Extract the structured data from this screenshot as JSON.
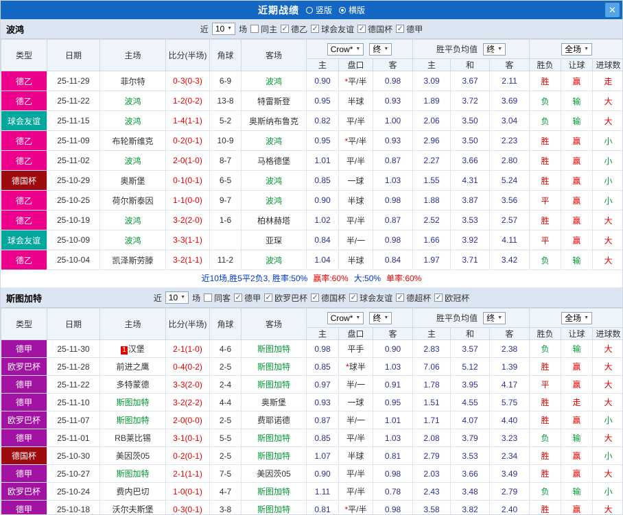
{
  "topbar": {
    "title": "近期战绩",
    "radio_vertical": "竖版",
    "radio_horizontal": "横版",
    "selected": "横版",
    "close_icon": "✕"
  },
  "table_header": {
    "col_type": "类型",
    "col_date": "日期",
    "col_home": "主场",
    "col_score": "比分(半场)",
    "col_corner": "角球",
    "col_away": "客场",
    "dd_company": "Crow*",
    "dd_final1": "终",
    "label_avg": "胜平负均值",
    "dd_final2": "终",
    "dd_fullmatch": "全场",
    "sub_home": "主",
    "sub_handicap": "盘口",
    "sub_away": "客",
    "sub_avg_home": "主",
    "sub_avg_draw": "和",
    "sub_avg_away": "客",
    "sub_result": "胜负",
    "sub_handicap_result": "让球",
    "sub_goals": "进球数"
  },
  "colors": {
    "league": {
      "德乙": "#EC008C",
      "球会友谊": "#00A79D",
      "德国杯": "#9E0B0F",
      "德甲": "#A313A3",
      "欧罗巴杯": "#A313A3"
    },
    "result": {
      "胜": "#E60000",
      "平": "#E60000",
      "负": "#009933",
      "赢": "#E60000",
      "输": "#009933",
      "走": "#E60000",
      "大": "#E60000",
      "小": "#009933"
    },
    "focus_team": "#009933",
    "score": "#E60000"
  },
  "sections": [
    {
      "team": "波鸿",
      "filter": {
        "recent_label": "近",
        "recent_value": "10",
        "matches_label": "场",
        "checkboxes": [
          {
            "label": "同主",
            "checked": false
          },
          {
            "label": "德乙",
            "checked": true
          },
          {
            "label": "球会友谊",
            "checked": true
          },
          {
            "label": "德国杯",
            "checked": true
          },
          {
            "label": "德甲",
            "checked": true
          }
        ]
      },
      "rows": [
        {
          "league": "德乙",
          "date": "25-11-29",
          "home": "菲尔特",
          "score": "0-3(0-3)",
          "corner": "6-9",
          "away": "波鸿",
          "odds": [
            "0.90",
            "*平/半",
            "0.98",
            "3.09",
            "3.67",
            "2.11"
          ],
          "results": [
            "胜",
            "赢",
            "走"
          ]
        },
        {
          "league": "德乙",
          "date": "25-11-22",
          "home": "波鸿",
          "score": "1-2(0-2)",
          "corner": "13-8",
          "away": "特雷斯登",
          "odds": [
            "0.95",
            "半球",
            "0.93",
            "1.89",
            "3.72",
            "3.69"
          ],
          "results": [
            "负",
            "输",
            "大"
          ]
        },
        {
          "league": "球会友谊",
          "date": "25-11-15",
          "home": "波鸿",
          "score": "1-4(1-1)",
          "corner": "5-2",
          "away": "奥斯纳布鲁克",
          "odds": [
            "0.82",
            "平/半",
            "1.00",
            "2.06",
            "3.50",
            "3.04"
          ],
          "results": [
            "负",
            "输",
            "大"
          ]
        },
        {
          "league": "德乙",
          "date": "25-11-09",
          "home": "布轮斯维克",
          "score": "0-2(0-1)",
          "corner": "10-9",
          "away": "波鸿",
          "odds": [
            "0.95",
            "*平/半",
            "0.93",
            "2.96",
            "3.50",
            "2.23"
          ],
          "results": [
            "胜",
            "赢",
            "小"
          ]
        },
        {
          "league": "德乙",
          "date": "25-11-02",
          "home": "波鸿",
          "score": "2-0(1-0)",
          "corner": "8-7",
          "away": "马格德堡",
          "odds": [
            "1.01",
            "平/半",
            "0.87",
            "2.27",
            "3.66",
            "2.80"
          ],
          "results": [
            "胜",
            "赢",
            "小"
          ]
        },
        {
          "league": "德国杯",
          "date": "25-10-29",
          "home": "奥斯堡",
          "score": "0-1(0-1)",
          "corner": "6-5",
          "away": "波鸿",
          "odds": [
            "0.85",
            "一球",
            "1.03",
            "1.55",
            "4.31",
            "5.24"
          ],
          "results": [
            "胜",
            "赢",
            "小"
          ]
        },
        {
          "league": "德乙",
          "date": "25-10-25",
          "home": "荷尔斯泰因",
          "score": "1-1(0-0)",
          "corner": "9-7",
          "away": "波鸿",
          "odds": [
            "0.90",
            "半球",
            "0.98",
            "1.88",
            "3.87",
            "3.56"
          ],
          "results": [
            "平",
            "赢",
            "小"
          ]
        },
        {
          "league": "德乙",
          "date": "25-10-19",
          "home": "波鸿",
          "score": "3-2(2-0)",
          "corner": "1-6",
          "away": "柏林赫塔",
          "odds": [
            "1.02",
            "平/半",
            "0.87",
            "2.52",
            "3.53",
            "2.57"
          ],
          "results": [
            "胜",
            "赢",
            "大"
          ]
        },
        {
          "league": "球会友谊",
          "date": "25-10-09",
          "home": "波鸿",
          "score": "3-3(1-1)",
          "corner": "",
          "away": "亚琛",
          "odds": [
            "0.84",
            "半/一",
            "0.98",
            "1.66",
            "3.92",
            "4.11"
          ],
          "results": [
            "平",
            "赢",
            "大"
          ]
        },
        {
          "league": "德乙",
          "date": "25-10-04",
          "home": "凯泽斯劳滕",
          "score": "3-2(1-1)",
          "corner": "11-2",
          "away": "波鸿",
          "odds": [
            "1.04",
            "半球",
            "0.84",
            "1.97",
            "3.71",
            "3.42"
          ],
          "results": [
            "负",
            "输",
            "大"
          ]
        }
      ],
      "summary": [
        {
          "text": "近10场,胜5平2负3, 胜率:50%",
          "color": "#0033CC"
        },
        {
          "text": "赢率:60%",
          "color": "#E60000"
        },
        {
          "text": "大:50%",
          "color": "#0033CC"
        },
        {
          "text": "单率:60%",
          "color": "#E60000"
        }
      ]
    },
    {
      "team": "斯图加特",
      "filter": {
        "recent_label": "近",
        "recent_value": "10",
        "matches_label": "场",
        "checkboxes": [
          {
            "label": "同客",
            "checked": false
          },
          {
            "label": "德甲",
            "checked": true
          },
          {
            "label": "欧罗巴杯",
            "checked": true
          },
          {
            "label": "德国杯",
            "checked": true
          },
          {
            "label": "球会友谊",
            "checked": true
          },
          {
            "label": "德超杯",
            "checked": true
          },
          {
            "label": "欧冠杯",
            "checked": true
          }
        ]
      },
      "rows": [
        {
          "league": "德甲",
          "date": "25-11-30",
          "home": "汉堡",
          "home_rank": "1",
          "score": "2-1(1-0)",
          "corner": "4-6",
          "away": "斯图加特",
          "odds": [
            "0.98",
            "平手",
            "0.90",
            "2.83",
            "3.57",
            "2.38"
          ],
          "results": [
            "负",
            "输",
            "大"
          ]
        },
        {
          "league": "欧罗巴杯",
          "date": "25-11-28",
          "home": "前进之鹰",
          "score": "0-4(0-2)",
          "corner": "2-5",
          "away": "斯图加特",
          "odds": [
            "0.85",
            "*球半",
            "1.03",
            "7.06",
            "5.12",
            "1.39"
          ],
          "results": [
            "胜",
            "赢",
            "大"
          ]
        },
        {
          "league": "德甲",
          "date": "25-11-22",
          "home": "多特蒙德",
          "score": "3-3(2-0)",
          "corner": "2-4",
          "away": "斯图加特",
          "odds": [
            "0.97",
            "半/一",
            "0.91",
            "1.78",
            "3.95",
            "4.17"
          ],
          "results": [
            "平",
            "赢",
            "大"
          ]
        },
        {
          "league": "德甲",
          "date": "25-11-10",
          "home": "斯图加特",
          "score": "3-2(2-2)",
          "corner": "4-4",
          "away": "奥斯堡",
          "odds": [
            "0.93",
            "一球",
            "0.95",
            "1.51",
            "4.55",
            "5.75"
          ],
          "results": [
            "胜",
            "走",
            "大"
          ]
        },
        {
          "league": "欧罗巴杯",
          "date": "25-11-07",
          "home": "斯图加特",
          "score": "2-0(0-0)",
          "corner": "2-5",
          "away": "费耶诺德",
          "odds": [
            "0.87",
            "半/一",
            "1.01",
            "1.71",
            "4.07",
            "4.40"
          ],
          "results": [
            "胜",
            "赢",
            "小"
          ]
        },
        {
          "league": "德甲",
          "date": "25-11-01",
          "home": "RB莱比锡",
          "score": "3-1(0-1)",
          "corner": "5-5",
          "away": "斯图加特",
          "odds": [
            "0.85",
            "平/半",
            "1.03",
            "2.08",
            "3.79",
            "3.23"
          ],
          "results": [
            "负",
            "输",
            "大"
          ]
        },
        {
          "league": "德国杯",
          "date": "25-10-30",
          "home": "美因茨05",
          "score": "0-2(0-1)",
          "corner": "2-5",
          "away": "斯图加特",
          "odds": [
            "1.07",
            "半球",
            "0.81",
            "2.79",
            "3.53",
            "2.34"
          ],
          "results": [
            "胜",
            "赢",
            "小"
          ]
        },
        {
          "league": "德甲",
          "date": "25-10-27",
          "home": "斯图加特",
          "score": "2-1(1-1)",
          "corner": "7-5",
          "away": "美因茨05",
          "odds": [
            "0.90",
            "平/半",
            "0.98",
            "2.03",
            "3.66",
            "3.49"
          ],
          "results": [
            "胜",
            "赢",
            "大"
          ]
        },
        {
          "league": "欧罗巴杯",
          "date": "25-10-24",
          "home": "费内巴切",
          "score": "1-0(0-1)",
          "corner": "4-7",
          "away": "斯图加特",
          "odds": [
            "1.11",
            "平/半",
            "0.78",
            "2.43",
            "3.48",
            "2.79"
          ],
          "results": [
            "负",
            "输",
            "小"
          ]
        },
        {
          "league": "德甲",
          "date": "25-10-18",
          "home": "沃尔夫斯堡",
          "score": "0-3(0-1)",
          "corner": "3-8",
          "away": "斯图加特",
          "odds": [
            "0.81",
            "*平/半",
            "0.98",
            "3.58",
            "3.82",
            "2.40"
          ],
          "results": [
            "胜",
            "赢",
            "大"
          ]
        }
      ],
      "summary": []
    }
  ]
}
